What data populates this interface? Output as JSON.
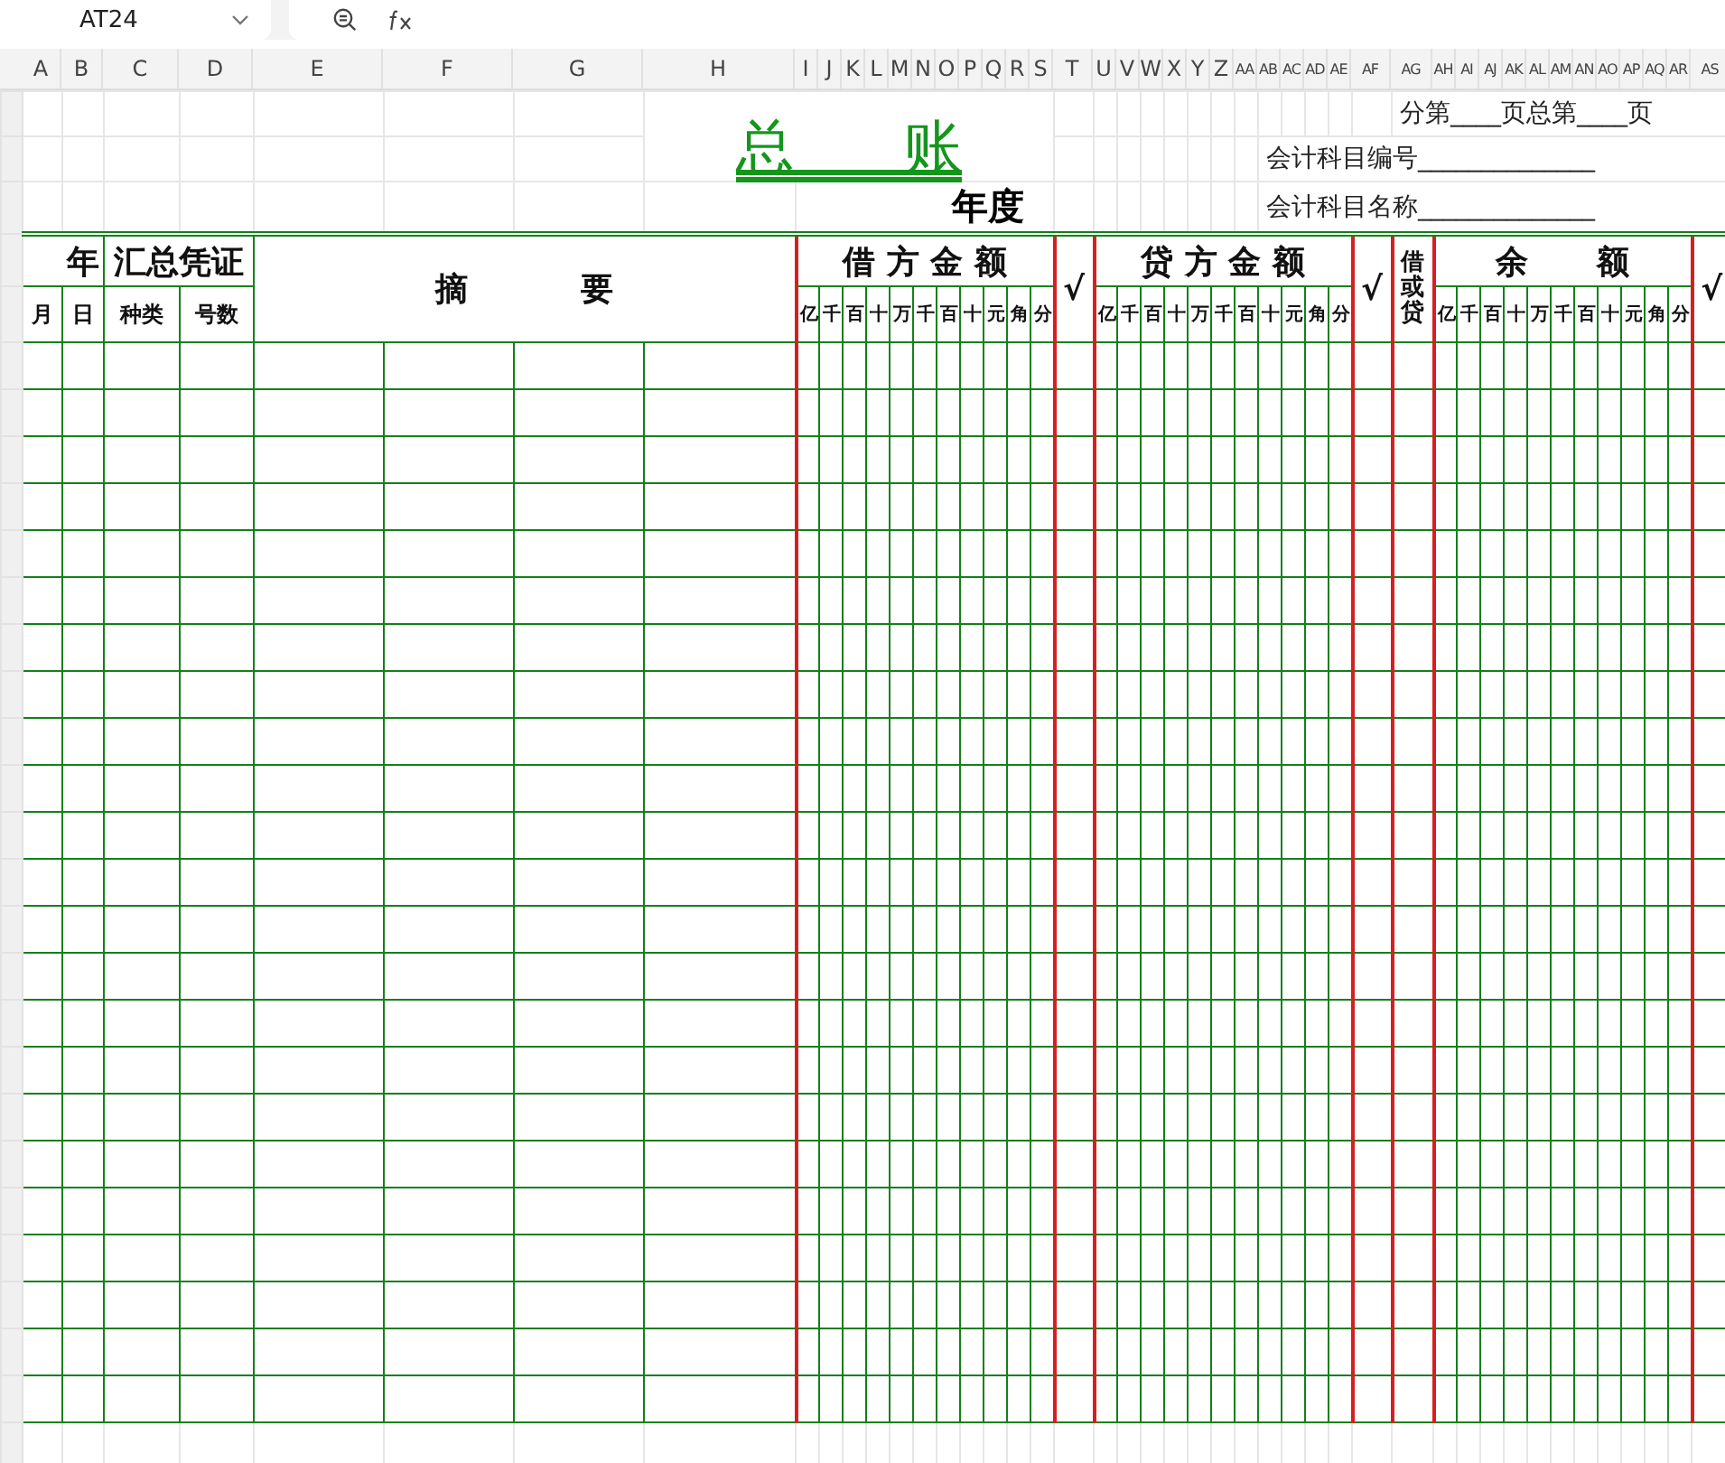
{
  "name_box": {
    "value": "AT24"
  },
  "column_headers": [
    "A",
    "B",
    "C",
    "D",
    "E",
    "F",
    "G",
    "H",
    "I",
    "J",
    "K",
    "L",
    "M",
    "N",
    "O",
    "P",
    "Q",
    "R",
    "S",
    "T",
    "U",
    "V",
    "W",
    "X",
    "Y",
    "Z",
    "AA",
    "AB",
    "AC",
    "AD",
    "AE",
    "AF",
    "AG",
    "AH",
    "AI",
    "AJ",
    "AK",
    "AL",
    "AM",
    "AN",
    "AO",
    "AP",
    "AQ",
    "AR",
    "AS"
  ],
  "title": "总      账",
  "page_number": "分第____页总第____页",
  "account_code": "会计科目编号______________",
  "year": "年度",
  "account_name": "会计科目名称______________",
  "ledger": {
    "year_header": "年",
    "voucher_header": "汇总凭证",
    "month": "月",
    "day": "日",
    "voucher_type": "种类",
    "voucher_number": "号数",
    "summary": "摘          要",
    "sections": [
      {
        "kind": "amount",
        "title": "借 方 金 额",
        "units": [
          "亿",
          "千",
          "百",
          "十",
          "万",
          "千",
          "百",
          "十",
          "元",
          "角",
          "分"
        ]
      },
      {
        "kind": "check",
        "title": "√"
      },
      {
        "kind": "amount",
        "title": "贷 方 金 额",
        "units": [
          "亿",
          "千",
          "百",
          "十",
          "万",
          "千",
          "百",
          "十",
          "元",
          "角",
          "分"
        ]
      },
      {
        "kind": "check",
        "title": "√"
      },
      {
        "kind": "direction",
        "title": "借或贷"
      },
      {
        "kind": "amount",
        "title": "余      额",
        "units": [
          "亿",
          "千",
          "百",
          "十",
          "万",
          "千",
          "百",
          "十",
          "元",
          "角",
          "分"
        ]
      },
      {
        "kind": "check",
        "title": "√"
      }
    ]
  }
}
